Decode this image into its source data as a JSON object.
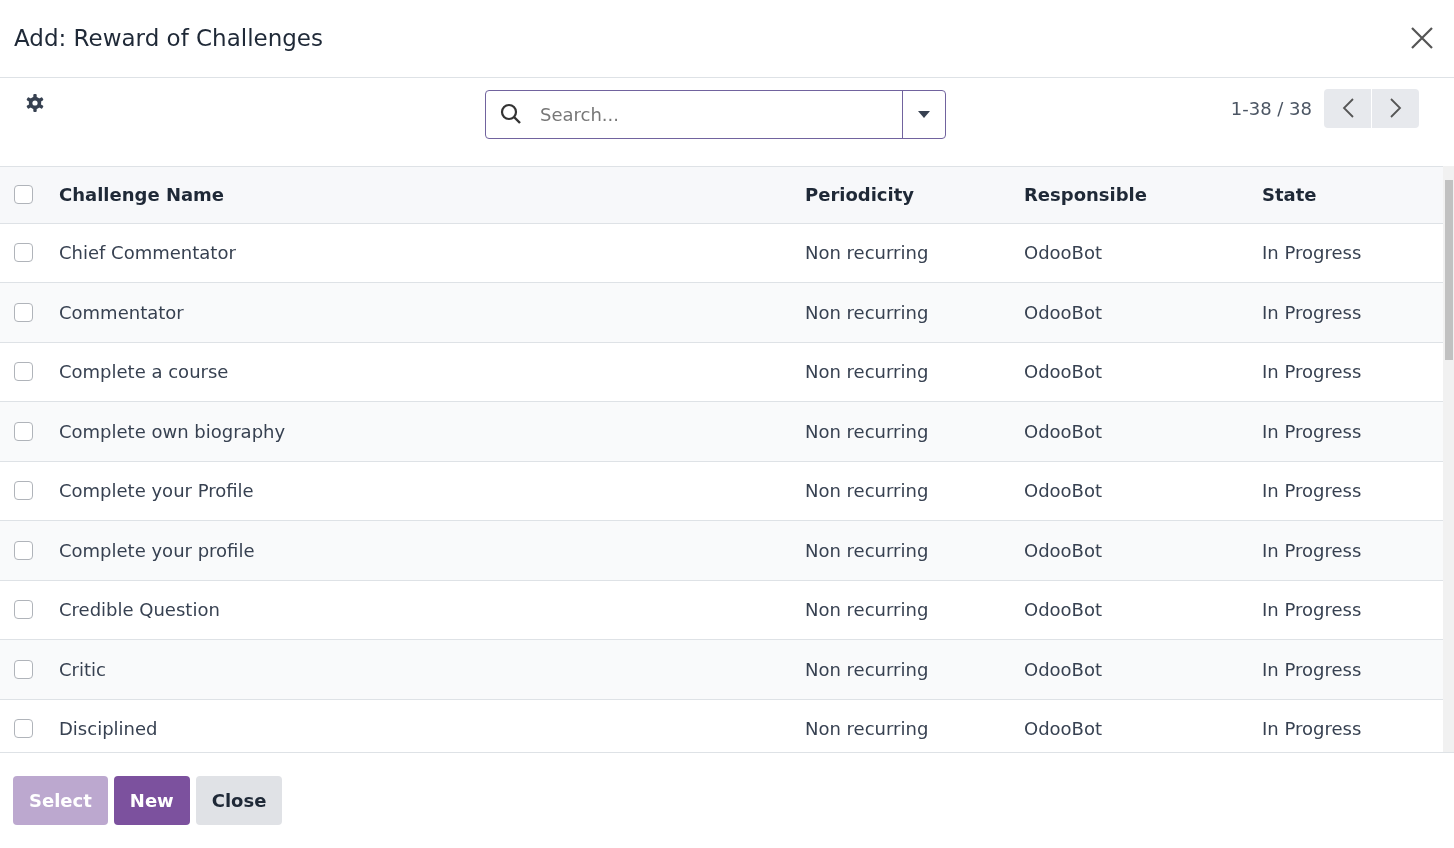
{
  "dialog": {
    "title": "Add: Reward of Challenges"
  },
  "search": {
    "placeholder": "Search..."
  },
  "pager": {
    "range": "1-38 / 38"
  },
  "table": {
    "columns": [
      "Challenge Name",
      "Periodicity",
      "Responsible",
      "State"
    ],
    "all_checked": false,
    "rows": [
      {
        "checked": false,
        "cells": [
          "Chief Commentator",
          "Non recurring",
          "OdooBot",
          "In Progress"
        ]
      },
      {
        "checked": false,
        "cells": [
          "Commentator",
          "Non recurring",
          "OdooBot",
          "In Progress"
        ]
      },
      {
        "checked": false,
        "cells": [
          "Complete a course",
          "Non recurring",
          "OdooBot",
          "In Progress"
        ]
      },
      {
        "checked": false,
        "cells": [
          "Complete own biography",
          "Non recurring",
          "OdooBot",
          "In Progress"
        ]
      },
      {
        "checked": false,
        "cells": [
          "Complete your Profile",
          "Non recurring",
          "OdooBot",
          "In Progress"
        ]
      },
      {
        "checked": false,
        "cells": [
          "Complete your profile",
          "Non recurring",
          "OdooBot",
          "In Progress"
        ]
      },
      {
        "checked": false,
        "cells": [
          "Credible Question",
          "Non recurring",
          "OdooBot",
          "In Progress"
        ]
      },
      {
        "checked": false,
        "cells": [
          "Critic",
          "Non recurring",
          "OdooBot",
          "In Progress"
        ]
      },
      {
        "checked": false,
        "cells": [
          "Disciplined",
          "Non recurring",
          "OdooBot",
          "In Progress"
        ]
      }
    ]
  },
  "buttons": [
    {
      "label": "Select",
      "kind": "primary",
      "disabled": true
    },
    {
      "label": "New",
      "kind": "primary",
      "disabled": false
    },
    {
      "label": "Close",
      "kind": "secondary",
      "disabled": false
    }
  ]
}
